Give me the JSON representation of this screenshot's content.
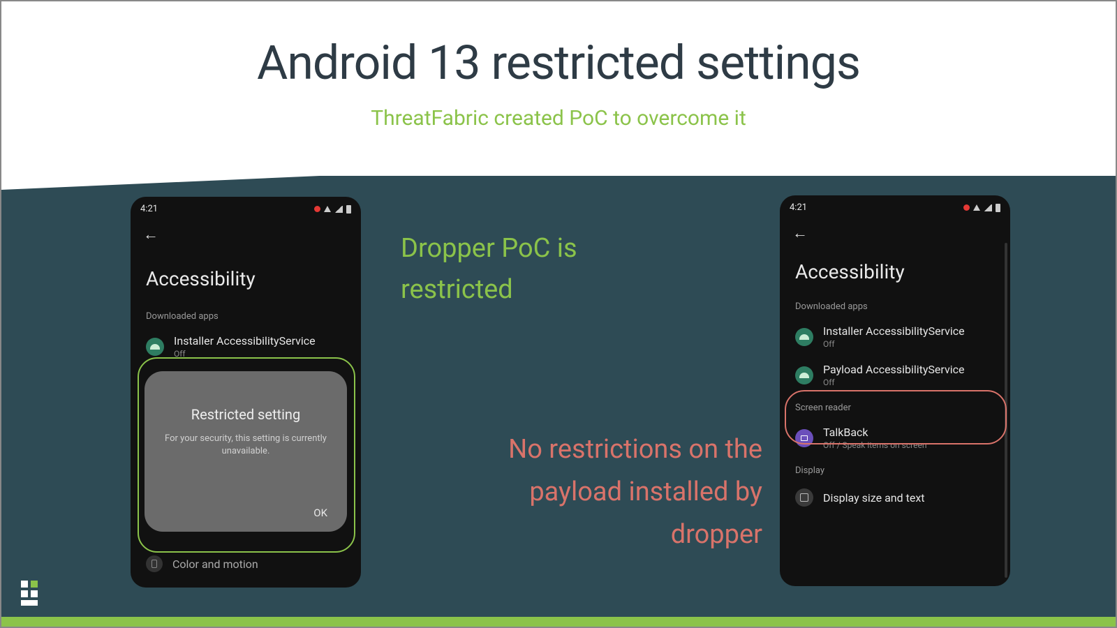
{
  "title": "Android 13 restricted settings",
  "subtitle": "ThreatFabric created PoC to overcome it",
  "caption_left": "Dropper PoC is restricted",
  "caption_right": "No restrictions on the payload installed by dropper",
  "phone_left": {
    "time": "4:21",
    "screen_title": "Accessibility",
    "section1": "Downloaded apps",
    "item1_title": "Installer AccessibilityService",
    "item1_sub": "Off",
    "dialog_title": "Restricted setting",
    "dialog_body": "For your security, this setting is currently unavailable.",
    "dialog_ok": "OK",
    "bottom_item": "Color and motion"
  },
  "phone_right": {
    "time": "4:21",
    "screen_title": "Accessibility",
    "section1": "Downloaded apps",
    "item1_title": "Installer AccessibilityService",
    "item1_sub": "Off",
    "item2_title": "Payload AccessibilityService",
    "item2_sub": "Off",
    "section2": "Screen reader",
    "talkback_title": "TalkBack",
    "talkback_sub": "Off / Speak items on screen",
    "section3": "Display",
    "display_item": "Display size and text"
  }
}
